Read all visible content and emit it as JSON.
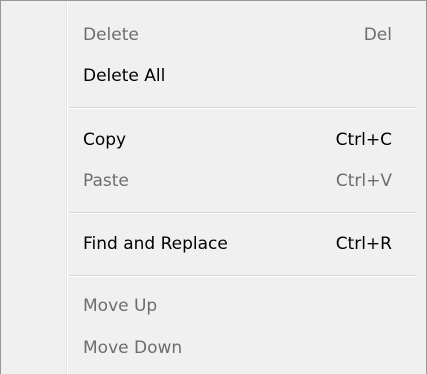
{
  "context_menu": {
    "items": [
      {
        "label": "Delete",
        "shortcut": "Del",
        "enabled": false
      },
      {
        "label": "Delete All",
        "shortcut": "",
        "enabled": true
      },
      {
        "label": "Copy",
        "shortcut": "Ctrl+C",
        "enabled": true
      },
      {
        "label": "Paste",
        "shortcut": "Ctrl+V",
        "enabled": false
      },
      {
        "label": "Find and Replace",
        "shortcut": "Ctrl+R",
        "enabled": true
      },
      {
        "label": "Move Up",
        "shortcut": "",
        "enabled": false
      },
      {
        "label": "Move Down",
        "shortcut": "",
        "enabled": false
      }
    ]
  }
}
